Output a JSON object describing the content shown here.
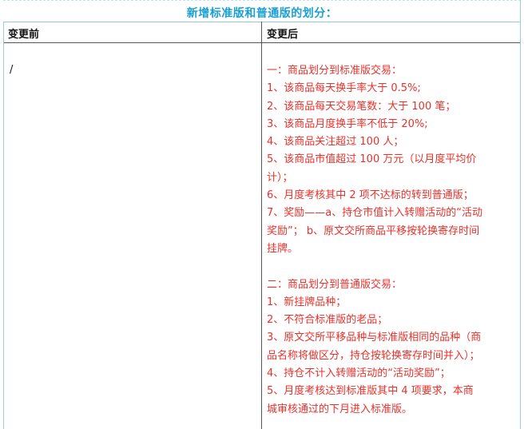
{
  "title": "新增标准版和普通版的划分：",
  "headers": {
    "before": "变更前",
    "after": "变更后"
  },
  "before_value": "/",
  "after_lines": [
    "一：商品划分到标准版交易：",
    "1、该商品每天换手率大于 0.5%;",
    "2、该商品每天交易笔数：大于 100 笔；",
    "3、该商品月度换手率不低于 20%;",
    "4、该商品关注超过 100 人；",
    "5、该商品市值超过 100 万元（以月度平均价",
    "计）；",
    "6、月度考核其中 2 项不达标的转到普通版；",
    "7、奖励——a、持仓市值计入转赠活动的“活动",
    "奖励”；  b、原文交所商品平移按轮换寄存时间",
    "挂牌。",
    "",
    "二：商品划分到普通版交易：",
    "1、新挂牌品种；",
    "2、不符合标准版的老品；",
    "3、原文交所平移品种与标准版相同的品种（商",
    "品名称将做区分，持仓按轮换寄存时间并入）；",
    "4、持仓不计入转赠活动的“活动奖励”；",
    "5、月度考核达到标准版其中 4 项要求，本商",
    "城审核通过的下月进入标准版。"
  ],
  "colors": {
    "title": "#1a9fd6",
    "rule_text": "#e8312b",
    "header_text": "#111111"
  }
}
